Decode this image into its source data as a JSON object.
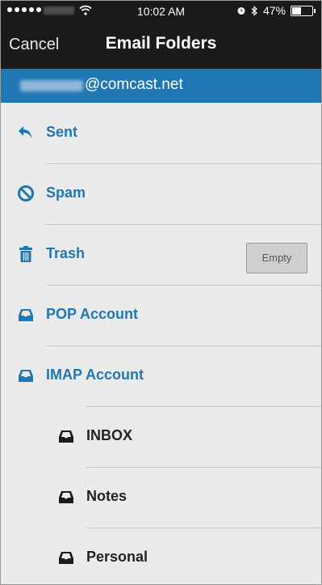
{
  "status_bar": {
    "time": "10:02 AM",
    "battery": "47%",
    "battery_level": 0.47,
    "icons": [
      "signal-dots-icon",
      "wifi-icon",
      "alarm-icon",
      "bluetooth-icon",
      "battery-icon"
    ]
  },
  "nav": {
    "cancel_label": "Cancel",
    "title": "Email Folders"
  },
  "account": {
    "email_domain": "@comcast.net"
  },
  "folders": [
    {
      "label": "Sent",
      "icon": "reply-arrow-icon"
    },
    {
      "label": "Spam",
      "icon": "prohibited-icon"
    },
    {
      "label": "Trash",
      "icon": "trash-icon",
      "action_label": "Empty"
    },
    {
      "label": "POP Account",
      "icon": "inbox-tray-icon"
    },
    {
      "label": "IMAP Account",
      "icon": "inbox-tray-icon"
    }
  ],
  "subfolders": [
    {
      "label": "INBOX",
      "icon": "inbox-tray-icon"
    },
    {
      "label": "Notes",
      "icon": "inbox-tray-icon"
    },
    {
      "label": "Personal",
      "icon": "inbox-tray-icon"
    }
  ],
  "colors": {
    "accent": "#1f77b4",
    "header_bg": "#1a1a1a",
    "list_bg": "#ebebeb"
  }
}
